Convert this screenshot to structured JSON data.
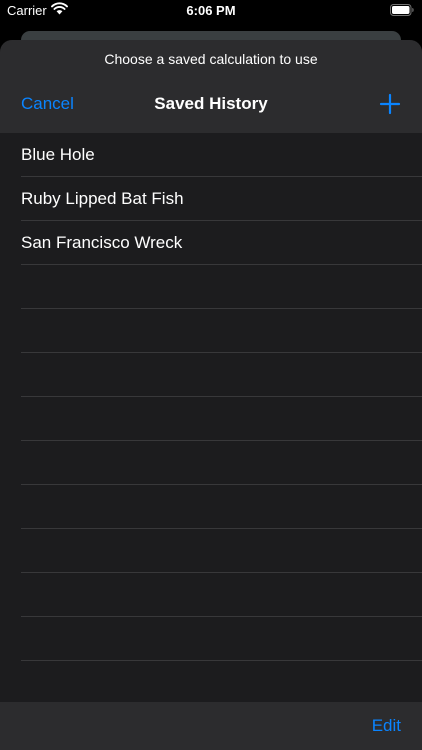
{
  "status_bar": {
    "carrier": "Carrier",
    "time": "6:06 PM",
    "wifi_icon": "wifi-icon",
    "battery_icon": "battery-full-icon"
  },
  "sheet": {
    "prompt": "Choose a saved calculation to use",
    "nav": {
      "cancel_label": "Cancel",
      "title": "Saved History",
      "add_icon": "plus-icon"
    },
    "items": [
      {
        "label": "Blue Hole"
      },
      {
        "label": "Ruby Lipped Bat Fish"
      },
      {
        "label": "San Francisco Wreck"
      },
      {
        "label": ""
      },
      {
        "label": ""
      },
      {
        "label": ""
      },
      {
        "label": ""
      },
      {
        "label": ""
      },
      {
        "label": ""
      },
      {
        "label": ""
      },
      {
        "label": ""
      },
      {
        "label": ""
      },
      {
        "label": ""
      }
    ],
    "toolbar": {
      "edit_label": "Edit"
    }
  },
  "colors": {
    "accent": "#0a84ff",
    "sheet_background": "#1c1c1e",
    "bar_background": "#2c2c2e",
    "separator": "#38383a"
  }
}
